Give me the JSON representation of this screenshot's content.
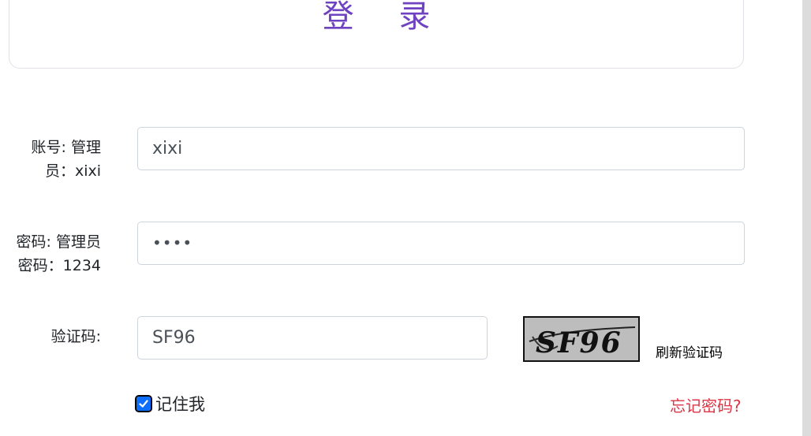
{
  "title": "登 录",
  "account": {
    "label_line1": "账号: 管理",
    "label_line2": "员：xixi",
    "value": "xixi"
  },
  "password": {
    "label_line1": "密码: 管理员",
    "label_line2": "密码：1234",
    "value": "••••"
  },
  "captcha": {
    "label": "验证码:",
    "value": "SF96",
    "image_text": "SF96",
    "refresh_label": "刷新验证码"
  },
  "remember": {
    "label": "记住我",
    "checked": true
  },
  "forgot_label": "忘记密码?",
  "colors": {
    "title": "#6f42c1",
    "forgot": "#dc3545",
    "checkbox": "#0d6efd"
  }
}
